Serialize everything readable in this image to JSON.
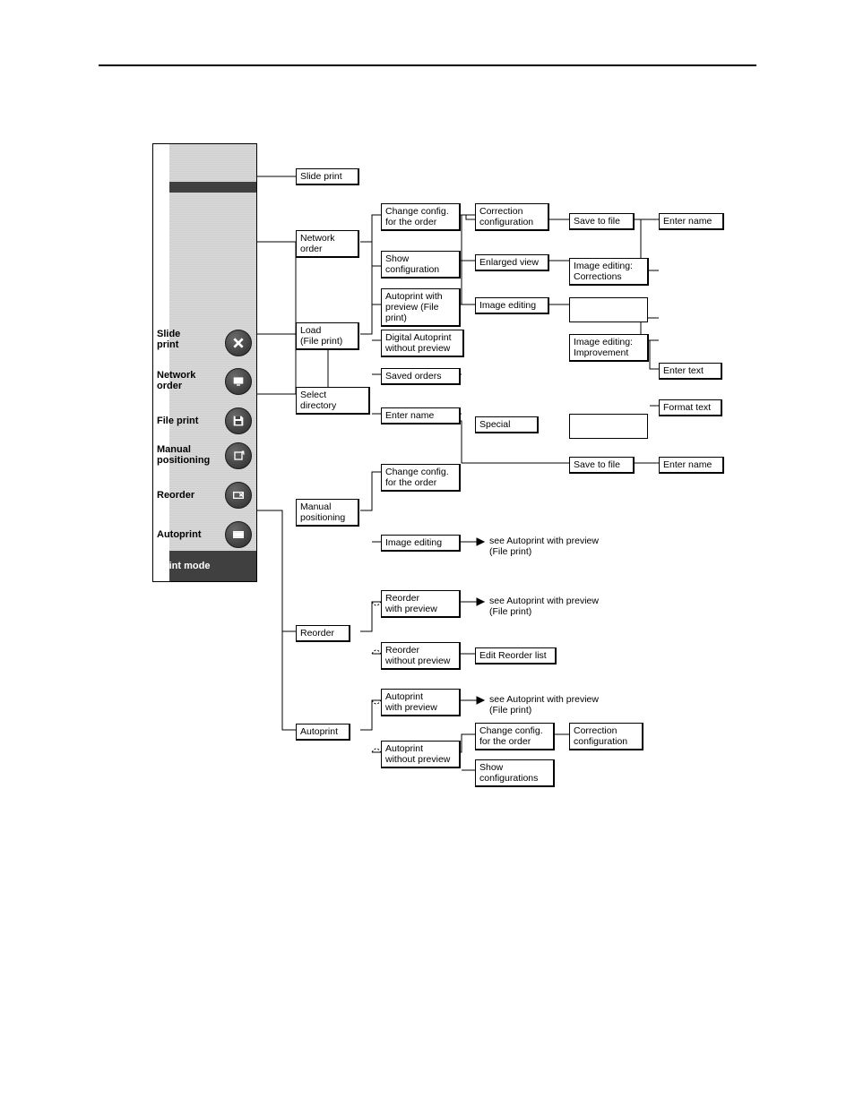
{
  "sidebar": {
    "items": [
      {
        "label": "Slide\nprint",
        "icon": "x-icon"
      },
      {
        "label": "Network\norder",
        "icon": "monitor-icon"
      },
      {
        "label": "File print",
        "icon": "floppy-icon"
      },
      {
        "label": "Manual\npositioning",
        "icon": "rotate-icon"
      },
      {
        "label": "Reorder",
        "icon": "frame-x-icon"
      },
      {
        "label": "Autoprint",
        "icon": "filmstrip-icon"
      }
    ],
    "bottom_label": "Print mode"
  },
  "boxes": {
    "slide_print": "Slide print",
    "network_order": "Network\norder",
    "load_file_print": "Load\n(File print)",
    "select_directory": "Select directory",
    "change_config_order_1": "Change config.\nfor the order",
    "show_configuration": "Show\nconfiguration",
    "autoprint_preview_fp": "Autoprint with\npreview (File\nprint)",
    "digital_autoprint_no_preview": "Digital Autoprint\nwithout preview",
    "saved_orders": "Saved orders",
    "enter_name_1": "Enter name",
    "special": "Special",
    "correction_configuration": "Correction\nconfiguration",
    "enlarged_view": "Enlarged view",
    "image_editing": "Image editing",
    "save_to_file_1": "Save to file",
    "enter_name_top": "Enter name",
    "image_editing_corrections": "Image editing:\nCorrections",
    "image_editing_improvement": "Image editing:\nImprovement",
    "enter_text": "Enter text",
    "format_text": "Format text",
    "save_to_file_2": "Save to file",
    "enter_name_2": "Enter name",
    "manual_positioning": "Manual\npositioning",
    "change_config_order_2": "Change config.\nfor the order",
    "image_editing_2": "Image editing",
    "reorder": "Reorder",
    "reorder_with_preview": "Reorder\nwith preview",
    "reorder_without_preview": "Reorder\nwithout preview",
    "edit_reorder_list": "Edit Reorder list",
    "autoprint": "Autoprint",
    "autoprint_with_preview": "Autoprint\nwith preview",
    "autoprint_without_preview": "Autoprint\nwithout preview",
    "change_config_order_3": "Change config.\nfor the order",
    "show_configurations": "Show\nconfigurations",
    "correction_configuration_2": "Correction\nconfiguration"
  },
  "annotations": {
    "see_autoprint_1": "see Autoprint with preview\n(File  print)",
    "see_autoprint_2": "see Autoprint with preview\n(File  print)",
    "see_autoprint_3": "see Autoprint with preview\n(File  print)"
  }
}
